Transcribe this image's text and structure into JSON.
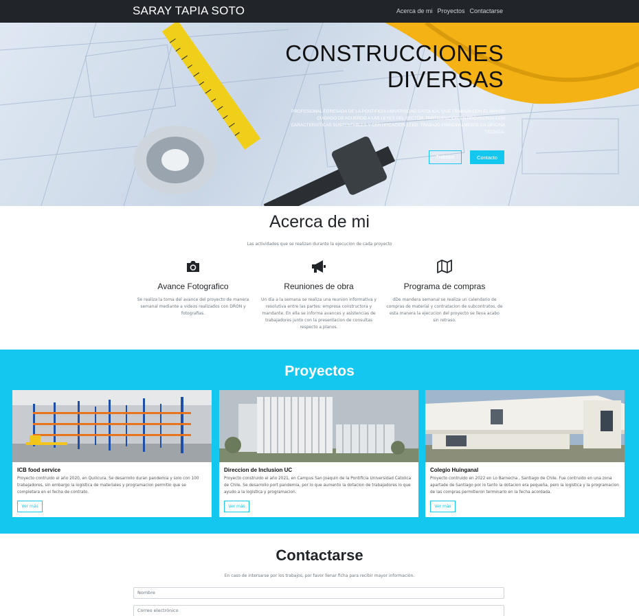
{
  "navbar": {
    "brand": "SARAY TAPIA SOTO",
    "links": [
      "Acerca de mi",
      "Proyectos",
      "Contactarse"
    ]
  },
  "hero": {
    "title_line1": "CONSTRUCCIONES",
    "title_line2": "DIVERSAS",
    "text": "PROFESIONAL EGRESADA DE LA PONTIFICIA UNIVERSIDAD CATOLICA, QUE TRABAJA CON EL MAYOR CUIDADO DE ACUERDO A LAS LEYES DEL SECTOR, PARTICIPACION EN PROYECTOS CON CARACTERISTICAS SUSTENTABLES Y CERTIFICACION LEED, TRABAJO PRINCIPALMENTE EN OFICINA TECNICA.",
    "btn_trabajos": "Trabajos",
    "btn_contacto": "Contacto"
  },
  "about": {
    "title": "Acerca de mi",
    "subtitle": "Las actividades que se realizan durante la ejecucion de cada proyecto",
    "features": [
      {
        "icon": "camera-icon",
        "title": "Avance Fotografico",
        "text": "Se realiza la toma del avance del proyecto de manera semanal mediante a videos realizados con DRON y fotografias."
      },
      {
        "icon": "megaphone-icon",
        "title": "Reuniones de obra",
        "text": "Un dia a la semana se realiza una reunion informativa y resolutiva entre las partes: empresa constructora y mandante. En ella se informa avances y asistencias de trabajadores junto con la presentacion de consultas respecto a planos."
      },
      {
        "icon": "map-icon",
        "title": "Programa de compras",
        "text": "dDe mandera semanal se realiza un calendario de compras de material y contratacion de subcontratos, de esta manera la ejecucion del proyecto se lleva acabo sin retraso."
      }
    ]
  },
  "projects": {
    "title": "Proyectos",
    "cards": [
      {
        "title": "ICB food service",
        "text": "Proyecto contruido el año 2020, en Quilicura. Se desarrollo duran pandemia y solo con 100 trabajadores, sin embargo la logistica de materiales y programacion permitio que se completara en el fecha de contrato.",
        "button": "Ver más"
      },
      {
        "title": "Direccion de Inclusion UC",
        "text": "Proyecto construido el año 2021, en Campus San Joaquin de la Pontificia Universidad Catolica de Chile. Se desarrollo port pandemia, por lo que aumento la dotacion de trabajadores lo que ayudo a la logistica y programacion.",
        "button": "Ver más"
      },
      {
        "title": "Colegio Huinganal",
        "text": "Proyecto contruido en 2022 en Lo Barnecha , Santiago de Chile. Fue contruido en una zona apartade de Santiago por lo tanto la dotacion era pequeña, pero la logistica y la programacion de las compras permitieron terminarlo en la fecha acordada.",
        "button": "Ver más"
      }
    ]
  },
  "contact": {
    "title": "Contactarse",
    "subtitle": "En caso de intersarse por los trabajos, por favor llenar ficha para recibir mayor información.",
    "name_placeholder": "Nombre",
    "email_placeholder": "Correo electrónico"
  },
  "colors": {
    "accent": "#13c7ee",
    "navbar": "#212529"
  }
}
